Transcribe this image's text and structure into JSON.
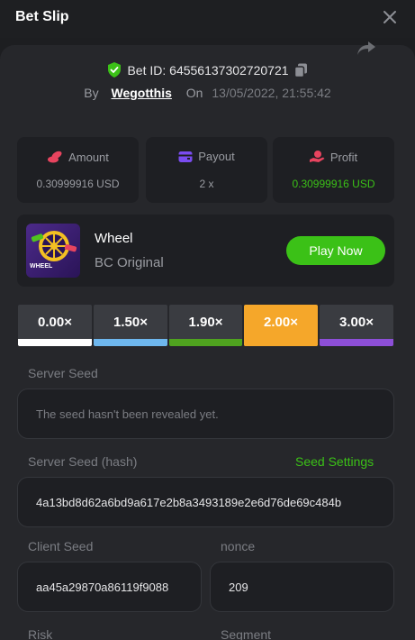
{
  "header": {
    "title": "Bet Slip"
  },
  "bet": {
    "id_label": "Bet ID: 64556137302720721",
    "by_label": "By",
    "user": "Wegotthis",
    "on_label": "On",
    "date": "13/05/2022, 21:55:42"
  },
  "stats": [
    {
      "label": "Amount",
      "value": "0.30999916 USD",
      "icon": "coins-icon",
      "color": "#e8445f"
    },
    {
      "label": "Payout",
      "value": "2 x",
      "icon": "wallet-icon",
      "color": "#7a4cf0"
    },
    {
      "label": "Profit",
      "value": "0.30999916 USD",
      "icon": "hand-coin-icon",
      "color": "#e8445f"
    }
  ],
  "game": {
    "name": "Wheel",
    "provider": "BC Original",
    "thumb_text": "WHEEL",
    "play_label": "Play Now"
  },
  "multipliers": [
    {
      "label": "0.00×",
      "color": "#ffffff",
      "active": false
    },
    {
      "label": "1.50×",
      "color": "#6eb7ee",
      "active": false
    },
    {
      "label": "1.90×",
      "color": "#4fa31f",
      "active": false
    },
    {
      "label": "2.00×",
      "color": "#f5a72a",
      "active": true
    },
    {
      "label": "3.00×",
      "color": "#8d4fd8",
      "active": false
    }
  ],
  "fields": {
    "server_seed_label": "Server Seed",
    "server_seed_value": "The seed hasn't been revealed yet.",
    "server_hash_label": "Server Seed (hash)",
    "seed_settings_label": "Seed Settings",
    "server_hash_value": "4a13bd8d62a6bd9a617e2b8a3493189e2e6d76de69c484b",
    "client_seed_label": "Client Seed",
    "client_seed_value": "aa45a29870a86119f9088",
    "nonce_label": "nonce",
    "nonce_value": "209",
    "risk_label": "Risk",
    "segment_label": "Segment"
  },
  "colors": {
    "accent_green": "#3bc117",
    "active_multiplier": "#f5a72a"
  }
}
